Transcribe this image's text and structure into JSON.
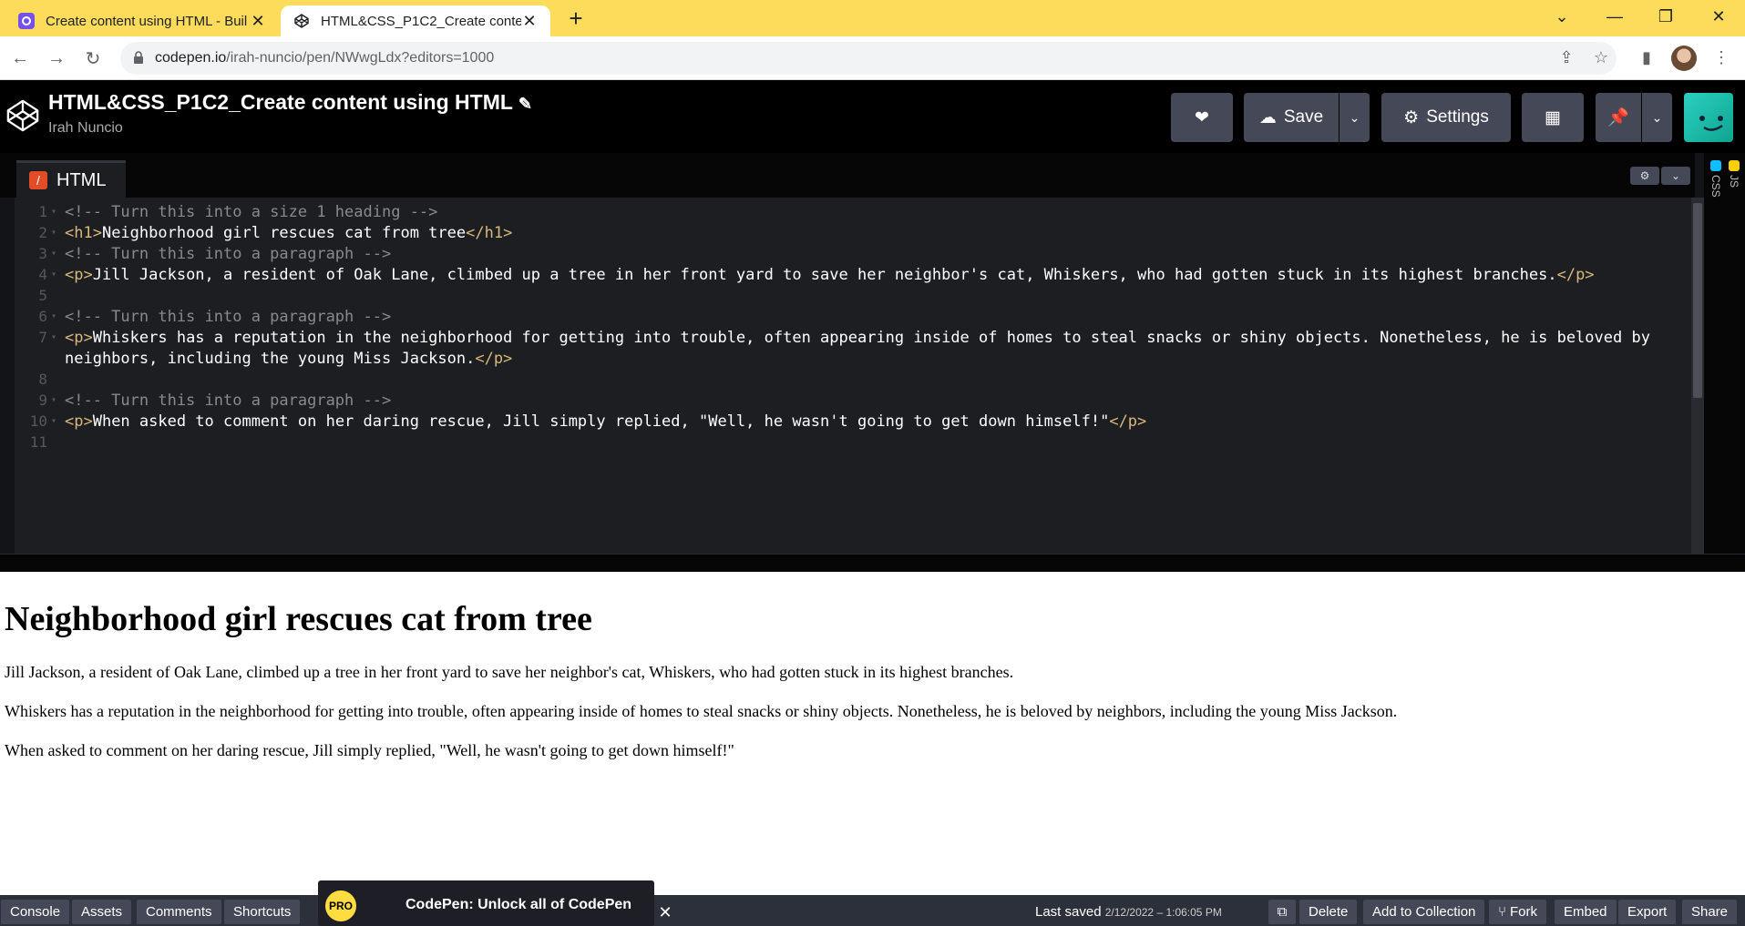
{
  "browser": {
    "tabs": [
      {
        "title": "Create content using HTML - Buil",
        "active": false
      },
      {
        "title": "HTML&CSS_P1C2_Create conten",
        "active": true
      }
    ],
    "url_host": "codepen.io",
    "url_path": "/irah-nuncio/pen/NWwgLdx?editors=1000"
  },
  "codepen": {
    "pen_title": "HTML&CSS_P1C2_Create content using HTML",
    "author": "Irah Nuncio",
    "save_label": "Save",
    "settings_label": "Settings",
    "html_tab_label": "HTML",
    "side_tabs": [
      "CSS",
      "JS"
    ]
  },
  "code_lines": [
    {
      "n": "1",
      "parts": [
        {
          "c": "cm",
          "t": "<!-- Turn this into a size 1 heading -->"
        }
      ]
    },
    {
      "n": "2",
      "parts": [
        {
          "c": "tg",
          "t": "<h1>"
        },
        {
          "c": "tx",
          "t": "Neighborhood girl rescues cat from tree"
        },
        {
          "c": "tg",
          "t": "</h1>"
        }
      ]
    },
    {
      "n": "3",
      "parts": [
        {
          "c": "cm",
          "t": "<!-- Turn this into a paragraph -->"
        }
      ]
    },
    {
      "n": "4",
      "parts": [
        {
          "c": "tg",
          "t": "<p>"
        },
        {
          "c": "tx",
          "t": "Jill Jackson, a resident of Oak Lane, climbed up a tree in her front yard to save her neighbor's cat, Whiskers, who had gotten stuck in its highest branches."
        },
        {
          "c": "tg",
          "t": "</p>"
        }
      ]
    },
    {
      "n": "5",
      "parts": []
    },
    {
      "n": "6",
      "parts": [
        {
          "c": "cm",
          "t": "<!-- Turn this into a paragraph -->"
        }
      ]
    },
    {
      "n": "7",
      "parts": [
        {
          "c": "tg",
          "t": "<p>"
        },
        {
          "c": "tx",
          "t": "Whiskers has a reputation in the neighborhood for getting into trouble, often appearing inside of homes to steal snacks or shiny objects. Nonetheless, he is beloved by"
        }
      ]
    },
    {
      "n": "",
      "parts": [
        {
          "c": "tx",
          "t": "neighbors, including the young Miss Jackson."
        },
        {
          "c": "tg",
          "t": "</p>"
        }
      ]
    },
    {
      "n": "8",
      "parts": []
    },
    {
      "n": "9",
      "parts": [
        {
          "c": "cm",
          "t": "<!-- Turn this into a paragraph -->"
        }
      ]
    },
    {
      "n": "10",
      "parts": [
        {
          "c": "tg",
          "t": "<p>"
        },
        {
          "c": "tx",
          "t": "When asked to comment on her daring rescue, Jill simply replied, \"Well, he wasn't going to get down himself!\""
        },
        {
          "c": "tg",
          "t": "</p>"
        }
      ]
    },
    {
      "n": "11",
      "parts": []
    }
  ],
  "preview": {
    "heading": "Neighborhood girl rescues cat from tree",
    "paragraphs": [
      "Jill Jackson, a resident of Oak Lane, climbed up a tree in her front yard to save her neighbor's cat, Whiskers, who had gotten stuck in its highest branches.",
      "Whiskers has a reputation in the neighborhood for getting into trouble, often appearing inside of homes to steal snacks or shiny objects. Nonetheless, he is beloved by neighbors, including the young Miss Jackson.",
      "When asked to comment on her daring rescue, Jill simply replied, \"Well, he wasn't going to get down himself!\""
    ]
  },
  "footer": {
    "left_buttons": [
      "Console",
      "Assets",
      "Comments",
      "Shortcuts"
    ],
    "pro_badge": "PRO",
    "promo_text": "CodePen: Unlock all of CodePen",
    "last_saved_label": "Last saved",
    "last_saved_time": "2/12/2022 – 1:06:05 PM",
    "right_buttons": [
      "Delete",
      "Add to Collection",
      "Fork",
      "Embed",
      "Export",
      "Share"
    ]
  },
  "colors": {
    "tab_strip": "#fddc5c",
    "editor_bg": "#1d1e22",
    "tag": "#d8b87b",
    "comment": "#88898f",
    "html_badge": "#e34c26"
  }
}
